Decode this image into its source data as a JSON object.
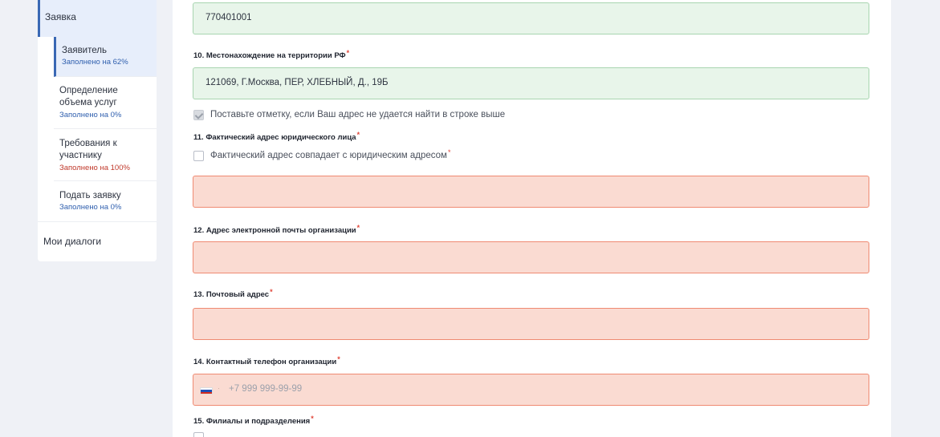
{
  "sidebar": {
    "header": "Заявка",
    "items": [
      {
        "label": "Заявитель",
        "status": "Заполнено на 62%",
        "status_color": "#2f5fae",
        "active": true
      },
      {
        "label": "Определение объема услуг",
        "status": "Заполнено на 0%",
        "status_color": "#2f5fae",
        "active": false
      },
      {
        "label": "Требования к участнику",
        "status": "Заполнено на 100%",
        "status_color": "#c0392b",
        "active": false
      },
      {
        "label": "Подать заявку",
        "status": "Заполнено на 0%",
        "status_color": "#2f5fae",
        "active": false
      }
    ],
    "bottom": "Мои диалоги"
  },
  "form": {
    "kpp_value": "770401001",
    "q10": {
      "label": "10. Местонахождение на территории РФ",
      "required": "*",
      "value": "121069, Г.Москва, ПЕР, ХЛЕБНЫЙ, Д., 19Б"
    },
    "address_not_found_checkbox": {
      "label": "Поставьте отметку, если Ваш адрес не удается найти в строке выше",
      "checked": true
    },
    "q11": {
      "label": "11. Фактический адрес юридического лица",
      "required": "*",
      "checkbox_label": "Фактический адрес совпадает с юридическим адресом",
      "checkbox_required": "*",
      "value": ""
    },
    "q12": {
      "label": "12. Адрес электронной почты организации",
      "required": "*",
      "value": ""
    },
    "q13": {
      "label": "13. Почтовый адрес",
      "required": "*",
      "value": ""
    },
    "q14": {
      "label": "14. Контактный телефон организации",
      "required": "*",
      "placeholder": "+7 999 999-99-99",
      "country_flag": "russia-flag-icon"
    },
    "q15": {
      "label": "15. Филиалы и подразделения",
      "required": "*"
    }
  },
  "colors": {
    "accent": "#3a68b4",
    "valid_field_bg": "#e8f5ea",
    "error_field_bg": "#fadbd2",
    "required_star": "#e0463a"
  }
}
